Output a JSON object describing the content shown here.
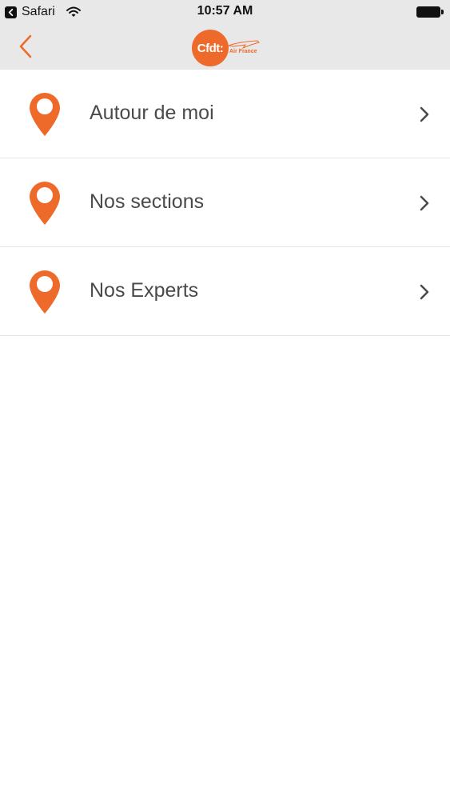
{
  "status_bar": {
    "carrier": "Safari",
    "time": "10:57 AM"
  },
  "nav": {
    "logo_text": "Cfdt:",
    "logo_subtext": "Air France"
  },
  "colors": {
    "accent": "#ee6a2a",
    "bar_background": "#e8e8e8",
    "text": "#4a4a4a"
  },
  "menu": {
    "items": [
      {
        "label": "Autour de moi",
        "icon": "map-pin-icon"
      },
      {
        "label": "Nos sections",
        "icon": "map-pin-icon"
      },
      {
        "label": "Nos Experts",
        "icon": "map-pin-icon"
      }
    ]
  }
}
